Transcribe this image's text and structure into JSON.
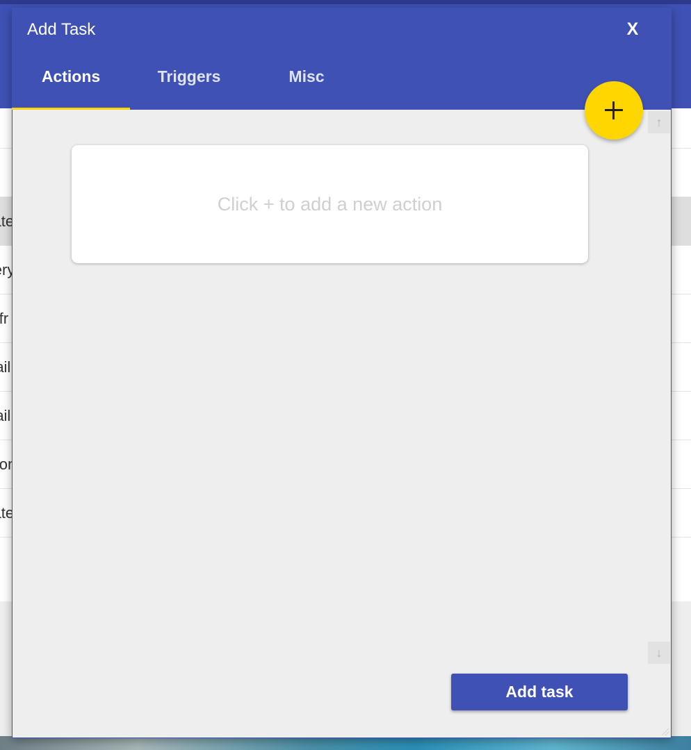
{
  "background_list": {
    "rows": [
      "",
      "",
      "Updates",
      "Every",
      "If fr",
      "Mail",
      "Mail",
      "Action",
      "Updates",
      ""
    ]
  },
  "dialog": {
    "title": "Add Task",
    "close_label": "X",
    "tabs": [
      {
        "label": "Actions",
        "active": true
      },
      {
        "label": "Triggers",
        "active": false
      },
      {
        "label": "Misc",
        "active": false
      }
    ],
    "fab_icon": "plus-icon",
    "empty_hint": "Click + to add a new action",
    "scroll_up_icon": "↑",
    "scroll_down_icon": "↓",
    "add_task_label": "Add task"
  },
  "colors": {
    "primary": "#3f51b5",
    "accent": "#ffd600",
    "dialog_body": "#eeeeee"
  }
}
